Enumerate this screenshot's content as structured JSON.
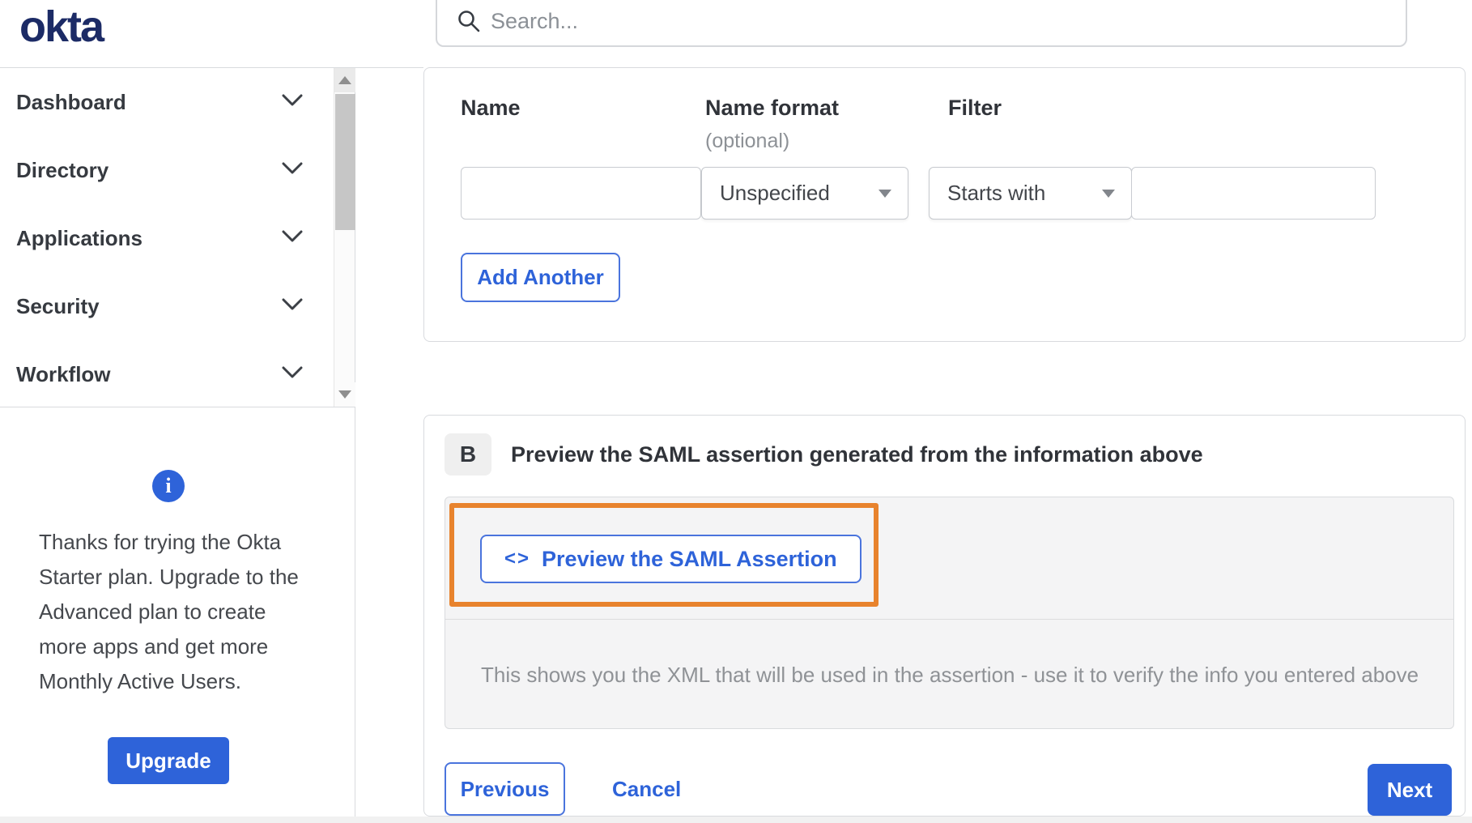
{
  "brand": {
    "logo_text": "okta"
  },
  "header": {
    "search_placeholder": "Search...",
    "search_value": ""
  },
  "sidebar": {
    "items": [
      {
        "label": "Dashboard"
      },
      {
        "label": "Directory"
      },
      {
        "label": "Applications"
      },
      {
        "label": "Security"
      },
      {
        "label": "Workflow"
      }
    ],
    "upsell": {
      "info_glyph": "i",
      "message": "Thanks for trying the Okta Starter plan. Upgrade to the Advanced plan to create more apps and get more Monthly Active Users.",
      "upgrade_label": "Upgrade"
    }
  },
  "attribute_form": {
    "name_label": "Name",
    "name_format_label": "Name format",
    "name_format_hint": "(optional)",
    "filter_label": "Filter",
    "name_value": "",
    "name_format_value": "Unspecified",
    "filter_type_value": "Starts with",
    "filter_value": "",
    "add_another_label": "Add Another"
  },
  "preview_section": {
    "step_badge": "B",
    "heading": "Preview the SAML assertion generated from the information above",
    "preview_button_icon": "<>",
    "preview_button_label": "Preview the SAML Assertion",
    "helper_text": "This shows you the XML that will be used in the assertion - use it to verify the info you entered above"
  },
  "footer_actions": {
    "previous_label": "Previous",
    "cancel_label": "Cancel",
    "next_label": "Next"
  },
  "colors": {
    "brand_navy": "#1c2b66",
    "accent_blue": "#2e63d9",
    "annotation_orange": "#e8832d",
    "text_dark": "#34383e",
    "text_gray": "#8d9196",
    "border_gray": "#d8dade",
    "panel_gray": "#f4f4f5"
  }
}
